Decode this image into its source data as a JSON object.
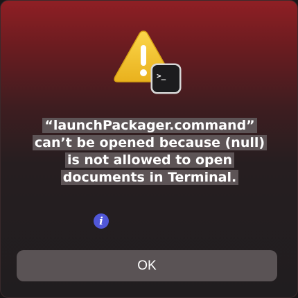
{
  "dialog": {
    "message": "“launchPackager.command” can’t be opened because (null) is not allowed to open documents in Terminal.",
    "warning_icon": "warning-triangle-icon",
    "app_icon": "terminal-app-icon",
    "terminal_prompt": ">_",
    "info_icon_glyph": "i",
    "ok_label": "OK"
  },
  "colors": {
    "warning_yellow": "#f0c12b",
    "info_blue": "#5057d8",
    "button_gray": "#5a5355",
    "text_highlight": "#5d5456"
  }
}
